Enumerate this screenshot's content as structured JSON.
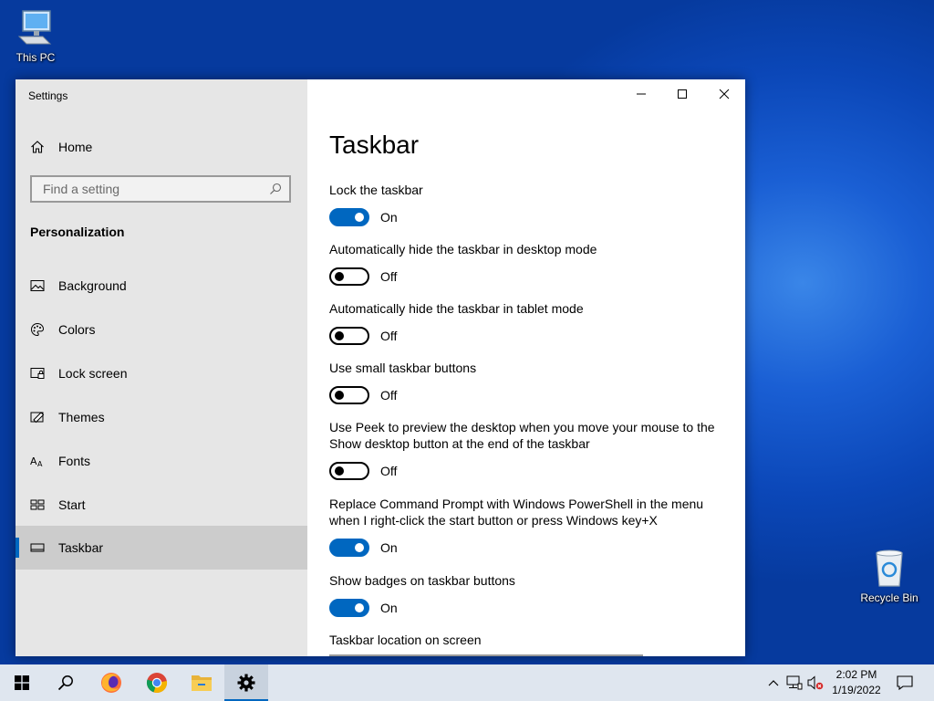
{
  "desktop": {
    "icons": [
      {
        "label": "This PC"
      },
      {
        "label": "Recycle Bin"
      }
    ]
  },
  "window": {
    "title": "Settings",
    "controls": {
      "minimize": "minimize",
      "maximize": "maximize",
      "close": "close"
    }
  },
  "sidebar": {
    "home_label": "Home",
    "search": {
      "placeholder": "Find a setting"
    },
    "section_title": "Personalization",
    "items": [
      {
        "label": "Background",
        "icon": "image-icon"
      },
      {
        "label": "Colors",
        "icon": "palette-icon"
      },
      {
        "label": "Lock screen",
        "icon": "lock-screen-icon"
      },
      {
        "label": "Themes",
        "icon": "themes-icon"
      },
      {
        "label": "Fonts",
        "icon": "fonts-icon"
      },
      {
        "label": "Start",
        "icon": "start-layout-icon"
      },
      {
        "label": "Taskbar",
        "icon": "taskbar-icon",
        "selected": true
      }
    ]
  },
  "main": {
    "title": "Taskbar",
    "settings": [
      {
        "label": "Lock the taskbar",
        "state": "On"
      },
      {
        "label": "Automatically hide the taskbar in desktop mode",
        "state": "Off"
      },
      {
        "label": "Automatically hide the taskbar in tablet mode",
        "state": "Off"
      },
      {
        "label": "Use small taskbar buttons",
        "state": "Off"
      },
      {
        "label": "Use Peek to preview the desktop when you move your mouse to the Show desktop button at the end of the taskbar",
        "state": "Off"
      },
      {
        "label": "Replace Command Prompt with Windows PowerShell in the menu when I right-click the start button or press Windows key+X",
        "state": "On"
      },
      {
        "label": "Show badges on taskbar buttons",
        "state": "On"
      }
    ],
    "location_label": "Taskbar location on screen"
  },
  "taskbar": {
    "apps": [
      "start",
      "search",
      "firefox",
      "chrome",
      "file-explorer",
      "settings"
    ],
    "clock": {
      "time": "2:02 PM",
      "date": "1/19/2022"
    }
  },
  "colors": {
    "accent": "#0067c0",
    "sidebar_bg": "#e6e6e6",
    "selected_bg": "#cccccc",
    "taskbar_bg": "#dfe6ef"
  }
}
